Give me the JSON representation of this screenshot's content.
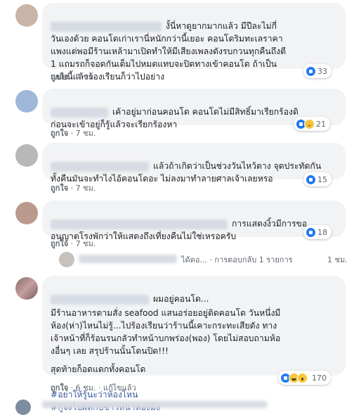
{
  "comments": [
    {
      "text": "งั้นี่หาดูยากมากแล้ว มีปีละไม่กี่\nวันเองด้วย คอนโดเก่าเรานี่หนักกว่านี้เยอะ คอนโดริมทะเลราคา\nแพงแต่พอมีร้านเหล้ามาเปิดทำให้มีเสียงเพลงดังรบกวนทุกคืนถึงตี\n1 แถมรถก็จอดกันเต็มไปหมดแทบจะปิดทางเข้าคอนโด ถ้าเป็น\nแบบนี้แล้วร้องเรียนก็ว่าไปอย่าง",
      "like": "ถูกใจ",
      "time": "7 ชม.",
      "reaction_count": "33"
    },
    {
      "text": "เค้าอยู่มาก่อนคอนโด คอนโดไม่มีสิทธิ์มาเรียกร้องดิ\nก่อนจะเข้าอยู่ก็รู้แล้วจะเรียกร้องหา",
      "like": "ถูกใจ",
      "time": "7 ชม.",
      "reaction_count": "21"
    },
    {
      "text": "แล้วถ้าเกิดว่าเป็นช่วงวันไหว้ตาง จุดประทัดกัน\nทั้งคืนมันจะทำไงไอ้คอนโดอะ ไม่ลงมาทำลายศาลเจ้าเลยหรอ",
      "like": "ถูกใจ",
      "time": "7 ชม.",
      "reaction_count": "15"
    },
    {
      "text": "การแสดงงิ้วมีการขอ\nอนุญาตโรงพักว่าให้แสดงถึงเที่ยงคืนไม่ใช่เหรอครับ",
      "like": "ถูกใจ",
      "time": "7 ชม.",
      "reaction_count": "18"
    },
    {
      "reply_preview": "ได้ตอ... · การตอบกลับ 1 รายการ",
      "reply_time": "1 ชม."
    },
    {
      "text_first": "ผมอยู่คอนโด...",
      "text": "มีร้านอาหารตามสั่ง seafood แสนอร่อยอยู่ติดคอนโด วันหนึ่งมี\nห้อง(ห่า)ไหนไม่รู้...ไปร้องเรียนว่าร้านนี้เคาะกระทะเสียดัง ทาง\nเจ้าหน้าที่ก็ร้อนรนกลัวทำหน้าบกพร่อง(พอง) โดยไม่สอบถามห้อ\nงอื่นๆ เลย สรุปร้านนั้นโดนปิด!!!",
      "text_end": "สุดท้ายก็อดแดกทั้งคอนโด",
      "hashtag_1": "#อย่าให้รู้นะว่าห้องไหน",
      "hashtag_2": "#กูจะไปผัดกับข้าวหน้าห้องมึง",
      "like": "ถูกใจ",
      "time": "6 ชม.",
      "edited": "แก้ไขแล้ว",
      "reaction_count": "170"
    }
  ]
}
